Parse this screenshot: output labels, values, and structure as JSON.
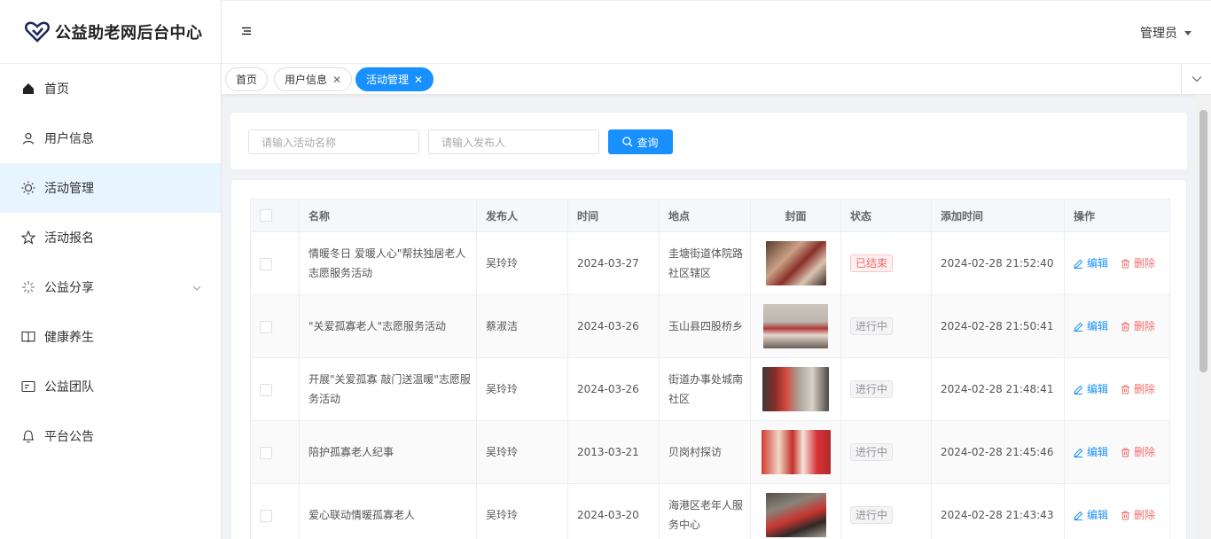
{
  "app": {
    "title": "公益助老网后台中心",
    "accent": "#1890ff"
  },
  "header": {
    "user_label": "管理员"
  },
  "sidebar": {
    "items": [
      {
        "label": "首页",
        "icon": "home-icon"
      },
      {
        "label": "用户信息",
        "icon": "user-icon"
      },
      {
        "label": "活动管理",
        "icon": "sun-icon"
      },
      {
        "label": "活动报名",
        "icon": "star-icon"
      },
      {
        "label": "公益分享",
        "icon": "sparkle-icon"
      },
      {
        "label": "健康养生",
        "icon": "book-icon"
      },
      {
        "label": "公益团队",
        "icon": "id-card-icon"
      },
      {
        "label": "平台公告",
        "icon": "bell-icon"
      }
    ]
  },
  "tabs": [
    {
      "label": "首页"
    },
    {
      "label": "用户信息"
    },
    {
      "label": "活动管理"
    }
  ],
  "search": {
    "name_placeholder": "请输入活动名称",
    "publisher_placeholder": "请输入发布人",
    "query_label": "查询"
  },
  "table": {
    "columns": [
      "名称",
      "发布人",
      "时间",
      "地点",
      "封面",
      "状态",
      "添加时间",
      "操作"
    ],
    "edit_label": "编辑",
    "delete_label": "删除",
    "rows": [
      {
        "name": "情暖冬日 爱暖人心\"帮扶独居老人志愿服务活动",
        "publisher": "吴玲玲",
        "date": "2024-03-27",
        "place": "圭塘街道体院路社区辖区",
        "status": "已结束",
        "added": "2024-02-28 21:52:40"
      },
      {
        "name": "\"关爱孤寡老人\"志愿服务活动",
        "publisher": "蔡淑洁",
        "date": "2024-03-26",
        "place": "玉山县四股桥乡",
        "status": "进行中",
        "added": "2024-02-28 21:50:41"
      },
      {
        "name": "开展\"关爱孤寡 敲门送温暖\"志愿服务活动",
        "publisher": "吴玲玲",
        "date": "2024-03-26",
        "place": "街道办事处城南社区",
        "status": "进行中",
        "added": "2024-02-28 21:48:41"
      },
      {
        "name": "陪护孤寡老人纪事",
        "publisher": "吴玲玲",
        "date": "2013-03-21",
        "place": "贝岗村探访",
        "status": "进行中",
        "added": "2024-02-28 21:45:46"
      },
      {
        "name": "爱心联动情暖孤寡老人",
        "publisher": "吴玲玲",
        "date": "2024-03-20",
        "place": "海港区老年人服务中心",
        "status": "进行中",
        "added": "2024-02-28 21:43:43"
      }
    ]
  }
}
